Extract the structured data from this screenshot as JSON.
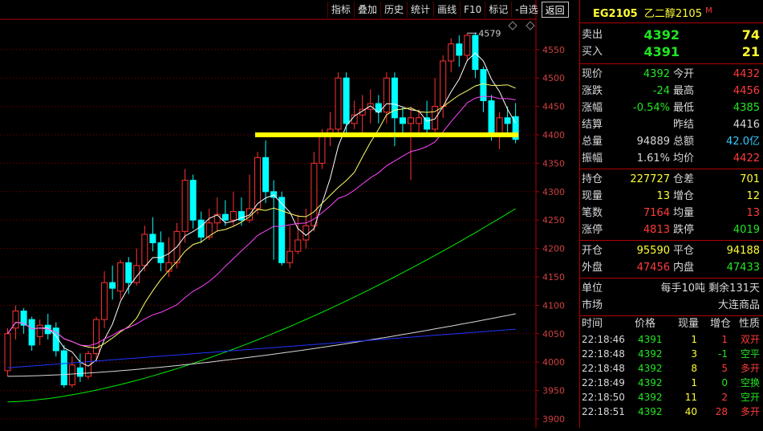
{
  "toolbar": [
    "指标",
    "叠加",
    "历史",
    "统计",
    "画线",
    "F10",
    "标记",
    "-自选",
    "返回"
  ],
  "chart": {
    "y_ticks": [
      "4550",
      "4500",
      "4450",
      "4400",
      "4350",
      "4300",
      "4250",
      "4200",
      "4150",
      "4100",
      "4050",
      "4000",
      "3950",
      "3900"
    ],
    "high_label": "4579",
    "support_line": 4400,
    "colors": {
      "up": "#ff3232",
      "down": "#00ffff",
      "ma5": "#ffffff",
      "ma10": "#ffff66",
      "ma20": "#ff44ff",
      "ma60": "#00ee00",
      "ma120": "#d8d8d8",
      "ma250": "#2233ff",
      "support": "#ffff00"
    }
  },
  "symbol": {
    "code": "EG2105",
    "name": "乙二醇2105",
    "flag": "M"
  },
  "quote": {
    "sell_label": "卖出",
    "sell_price": "4392",
    "sell_vol": "74",
    "buy_label": "买入",
    "buy_price": "4391",
    "buy_vol": "21"
  },
  "stats1": [
    {
      "l1": "现价",
      "v1": "4392",
      "l2": "今开",
      "v2": "4432"
    },
    {
      "l1": "涨跌",
      "v1": "-24",
      "l2": "最高",
      "v2": "4456"
    },
    {
      "l1": "涨幅",
      "v1": "-0.54%",
      "l2": "最低",
      "v2": "4385"
    },
    {
      "l1": "结算",
      "v1": "",
      "l2": "昨结",
      "v2": "4416"
    },
    {
      "l1": "总量",
      "v1": "94889",
      "l2": "总额",
      "v2": "42.0亿"
    },
    {
      "l1": "振幅",
      "v1": "1.61%",
      "l2": "均价",
      "v2": "4422"
    }
  ],
  "stats2": [
    {
      "l1": "持仓",
      "v1": "227727",
      "l2": "仓差",
      "v2": "701"
    },
    {
      "l1": "现量",
      "v1": "13",
      "l2": "增仓",
      "v2": "12"
    },
    {
      "l1": "笔数",
      "v1": "7164",
      "l2": "均量",
      "v2": "13"
    },
    {
      "l1": "涨停",
      "v1": "4813",
      "l2": "跌停",
      "v2": "4019"
    }
  ],
  "stats3": [
    {
      "l1": "开仓",
      "v1": "95590",
      "l2": "平仓",
      "v2": "94188"
    },
    {
      "l1": "外盘",
      "v1": "47456",
      "l2": "内盘",
      "v2": "47433"
    }
  ],
  "info": [
    {
      "label": "单位",
      "value": "每手10吨 剩余131天"
    },
    {
      "label": "市场",
      "value": "大连商品"
    }
  ],
  "trades_header": [
    "时间",
    "价格",
    "现量",
    "增仓",
    "性质"
  ],
  "trades": [
    {
      "time": "22:18:46",
      "price": "4391",
      "vol": "1",
      "inc": "1",
      "nature": "双开"
    },
    {
      "time": "22:18:48",
      "price": "4392",
      "vol": "3",
      "inc": "-1",
      "nature": "空平"
    },
    {
      "time": "22:18:48",
      "price": "4392",
      "vol": "8",
      "inc": "5",
      "nature": "多开"
    },
    {
      "time": "22:18:49",
      "price": "4392",
      "vol": "1",
      "inc": "0",
      "nature": "空换"
    },
    {
      "time": "22:18:50",
      "price": "4392",
      "vol": "11",
      "inc": "2",
      "nature": "空开"
    },
    {
      "time": "22:18:51",
      "price": "4392",
      "vol": "40",
      "inc": "28",
      "nature": "多开"
    }
  ]
}
